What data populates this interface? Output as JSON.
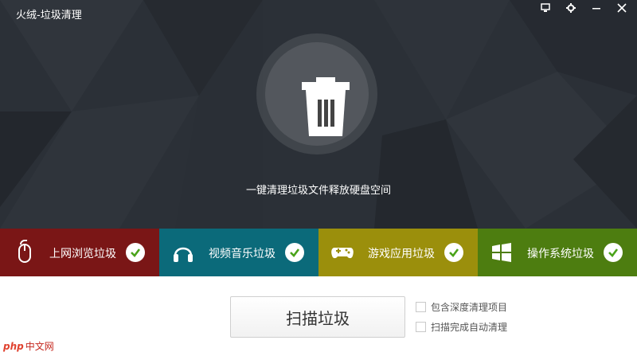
{
  "window": {
    "title": "火绒-垃圾清理",
    "controls": [
      "monitor-icon",
      "gear-icon",
      "minimize-icon",
      "close-icon"
    ]
  },
  "hero": {
    "caption": "一键清理垃圾文件释放硬盘空间",
    "icon": "trash-icon"
  },
  "categories": [
    {
      "label": "上网浏览垃圾",
      "icon": "mouse-icon",
      "color": "#7a1616"
    },
    {
      "label": "视频音乐垃圾",
      "icon": "headphones-icon",
      "color": "#0b6a7a"
    },
    {
      "label": "游戏应用垃圾",
      "icon": "gamepad-icon",
      "color": "#9b8f0c"
    },
    {
      "label": "操作系统垃圾",
      "icon": "windows-icon",
      "color": "#4d7d10"
    }
  ],
  "actions": {
    "scan_label": "扫描垃圾",
    "option_deep": "包含深度清理项目",
    "option_auto": "扫描完成自动清理"
  },
  "watermark": {
    "php": "php",
    "text": "中文网"
  }
}
